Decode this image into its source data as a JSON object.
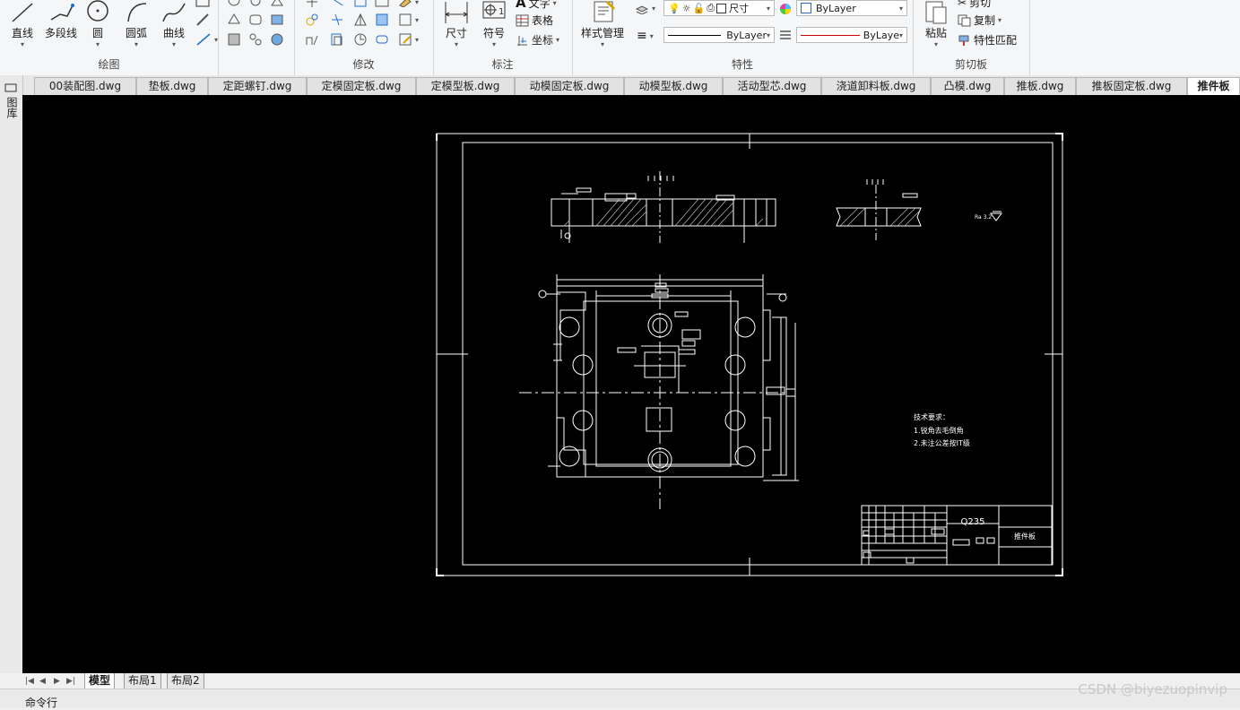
{
  "ribbon": {
    "draw": {
      "title": "绘图",
      "line": "直线",
      "polyline": "多段线",
      "circle": "圆",
      "arc": "圆弧",
      "curve": "曲线"
    },
    "modify": {
      "title": "修改"
    },
    "annotate": {
      "title": "标注",
      "dimension": "尺寸",
      "symbol": "符号",
      "text": "文字",
      "table": "表格",
      "coordinate": "坐标"
    },
    "properties": {
      "title": "特性",
      "style_manager": "样式管理",
      "layer_value": "尺寸",
      "color_value": "ByLayer",
      "linetype_value": "ByLayer",
      "lineweight_value": "ByLaye"
    },
    "clipboard": {
      "title": "剪切板",
      "paste": "粘贴",
      "cut": "剪切",
      "copy": "复制",
      "match": "特性匹配"
    }
  },
  "tabs": [
    {
      "label": "00装配图.dwg"
    },
    {
      "label": "垫板.dwg"
    },
    {
      "label": "定距螺钉.dwg"
    },
    {
      "label": "定模固定板.dwg"
    },
    {
      "label": "定模型板.dwg"
    },
    {
      "label": "动模固定板.dwg"
    },
    {
      "label": "动模型板.dwg"
    },
    {
      "label": "活动型芯.dwg"
    },
    {
      "label": "浇道卸料板.dwg"
    },
    {
      "label": "凸模.dwg"
    },
    {
      "label": "推板.dwg"
    },
    {
      "label": "推板固定板.dwg"
    },
    {
      "label": "推件板"
    }
  ],
  "sidebar": {
    "label": "图库"
  },
  "drawing": {
    "material": "Q235",
    "part_name": "推件板",
    "tech_title": "技术要求：",
    "tech_note_1": "1.锐角去毛倒角",
    "tech_note_2": "2.未注公差按IT级",
    "roughness": "Ra 3.2"
  },
  "layout_tabs": {
    "model": "模型",
    "layout1": "布局1",
    "layout2": "布局2"
  },
  "command": {
    "label": "命令行"
  },
  "watermark": "CSDN @biyezuopinvip",
  "colors": {
    "canvas": "#000000",
    "drawing_line": "#ffffff",
    "linetype_accent": "#d00000",
    "accent_blue": "#1f6fd1"
  }
}
